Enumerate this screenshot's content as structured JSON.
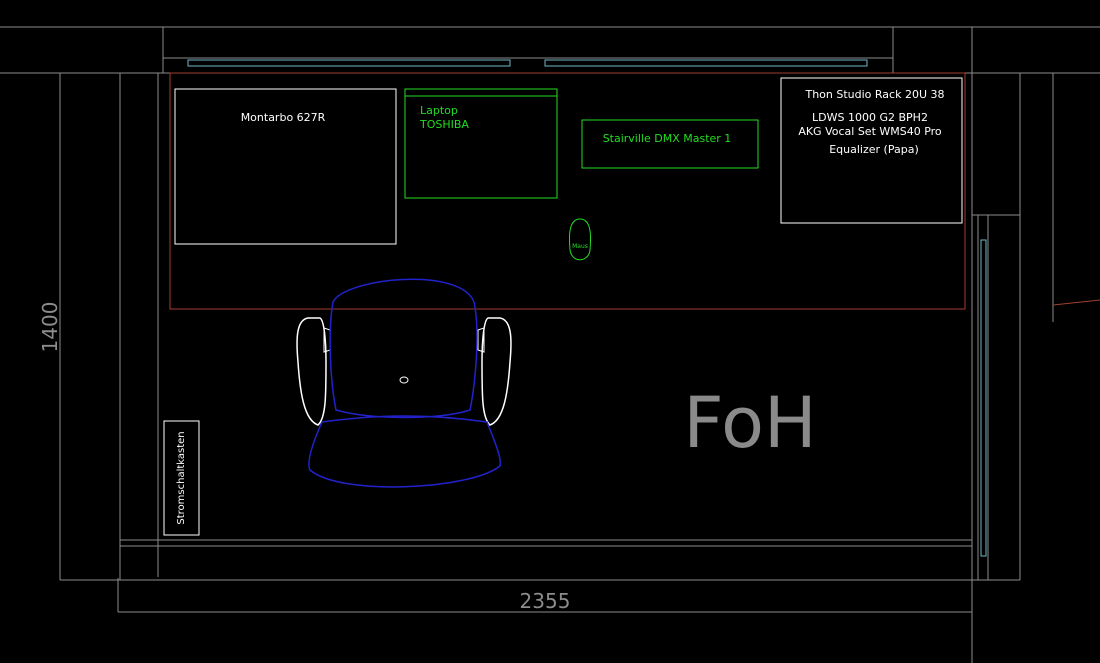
{
  "dimensions": {
    "width_label": "2355",
    "height_label": "1400"
  },
  "room": {
    "name": "FoH"
  },
  "equipment": {
    "speaker": "Montarbo 627R",
    "laptop_title": "Laptop",
    "laptop_brand": "TOSHIBA",
    "dmx": "Stairville DMX Master 1",
    "rack_title": "Thon Studio Rack 20U 38",
    "rack_items": [
      "LDWS 1000 G2 BPH2",
      "AKG Vocal Set WMS40 Pro",
      "Equalizer (Papa)"
    ],
    "mouse": "Maus",
    "power_box": "Stromschaltkasten"
  },
  "colors": {
    "structure": "#8c8c8c",
    "furniture": "#ffffff",
    "electronics": "#22dd22",
    "chair_seat": "#2222cc",
    "desk_outline": "#a04030",
    "window": "#6fb8c8",
    "room_label": "#8a8a8a"
  }
}
